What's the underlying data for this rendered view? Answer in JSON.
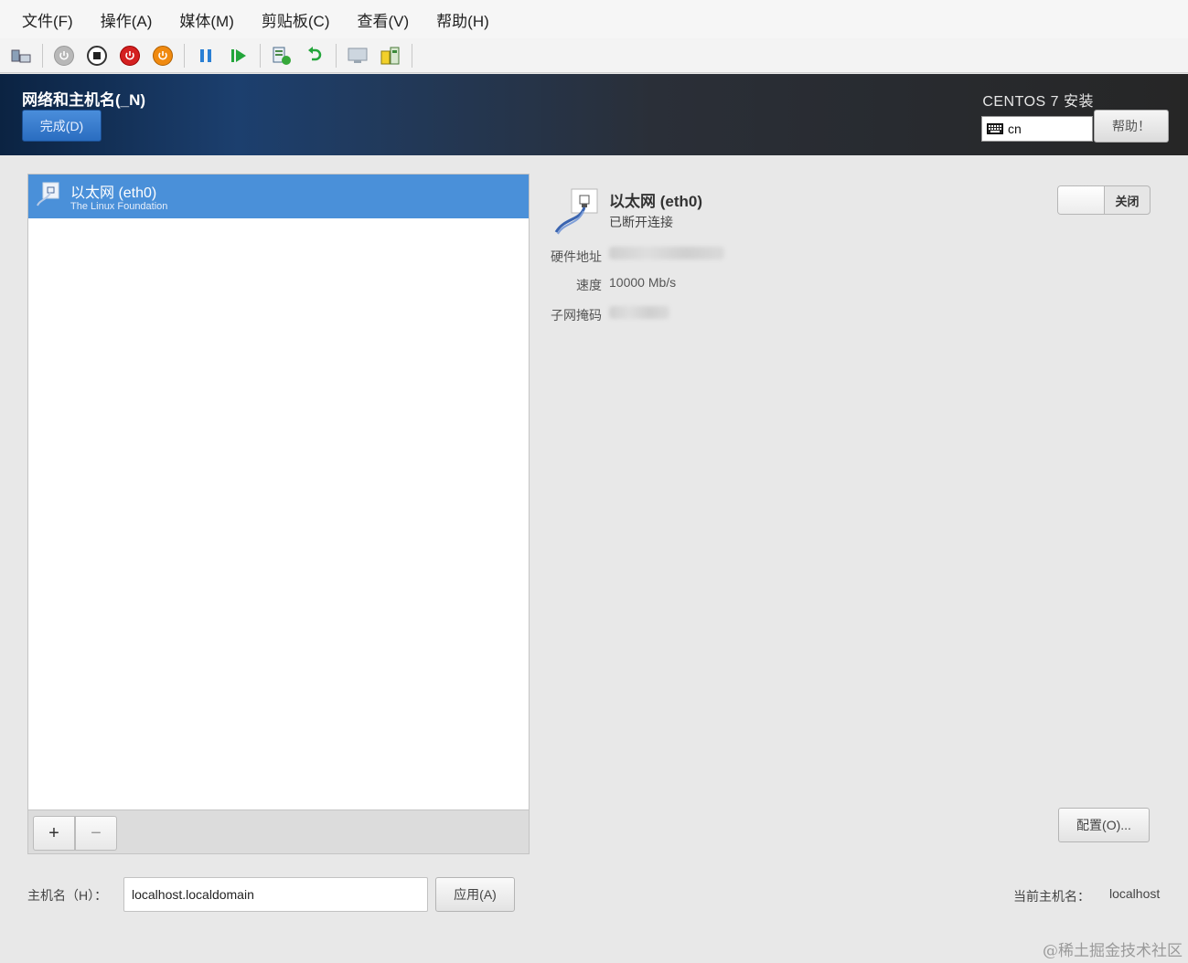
{
  "menubar": {
    "items": [
      "文件(F)",
      "操作(A)",
      "媒体(M)",
      "剪贴板(C)",
      "查看(V)",
      "帮助(H)"
    ]
  },
  "toolbar": {
    "icons": [
      "ctrl-alt-del-icon",
      "start-icon",
      "turn-off-icon",
      "shutdown-icon",
      "reset-icon",
      "pause-icon",
      "resume-icon",
      "checkpoint-icon",
      "revert-icon",
      "enhanced-session-icon",
      "share-icon"
    ]
  },
  "header": {
    "title": "网络和主机名(_N)",
    "done_label": "完成(D)",
    "product_title": "CENTOS 7 安装",
    "keyboard_layout": "cn",
    "help_label": "帮助！"
  },
  "device_list": {
    "items": [
      {
        "name": "以太网 (eth0)",
        "vendor": "The Linux Foundation"
      }
    ],
    "add_label": "+",
    "remove_label": "−"
  },
  "device_details": {
    "name": "以太网 (eth0)",
    "status": "已断开连接",
    "hardware_label": "硬件地址",
    "speed_label": "速度",
    "speed_value": "10000 Mb/s",
    "subnet_label": "子网掩码",
    "toggle_label": "关闭",
    "toggle_on": false,
    "config_label": "配置(O)..."
  },
  "hostname": {
    "label": "主机名（H）：",
    "value": "localhost.localdomain",
    "apply_label": "应用(A)",
    "current_label": "当前主机名：",
    "current_value": "localhost"
  },
  "watermark": "@稀土掘金技术社区",
  "colors": {
    "selection": "#4a90d9",
    "done_button": "#3a7fd0",
    "header_dark": "#262626"
  }
}
